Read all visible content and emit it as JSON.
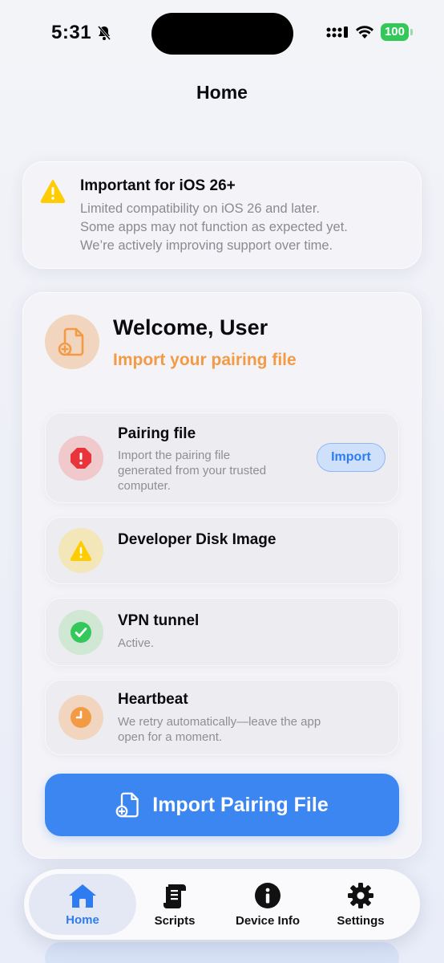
{
  "status_bar": {
    "time": "5:31",
    "battery": "100"
  },
  "nav": {
    "title": "Home"
  },
  "notice": {
    "title": "Important for iOS 26+",
    "lines": [
      "Limited compatibility on iOS 26 and later.",
      "Some apps may not function as expected yet.",
      "We’re actively improving support over time."
    ]
  },
  "welcome": {
    "title": "Welcome, User",
    "subtitle": "Import your pairing file"
  },
  "rows": [
    {
      "title": "Pairing file",
      "desc_lines": [
        "Import the pairing file",
        "generated from your trusted",
        "computer."
      ],
      "action": "Import",
      "status": "error"
    },
    {
      "title": "Developer Disk Image",
      "status": "warning"
    },
    {
      "title": "VPN tunnel",
      "desc_lines": [
        "Active."
      ],
      "status": "ok"
    },
    {
      "title": "Heartbeat",
      "desc_lines": [
        "We retry automatically—leave the app",
        "open for a moment."
      ],
      "status": "pending"
    }
  ],
  "primary_button": {
    "label": "Import Pairing File"
  },
  "tabs": [
    {
      "label": "Home",
      "icon": "house-icon"
    },
    {
      "label": "Scripts",
      "icon": "scroll-icon"
    },
    {
      "label": "Device Info",
      "icon": "info-icon"
    },
    {
      "label": "Settings",
      "icon": "gear-icon"
    }
  ],
  "colors": {
    "accent": "#3c86f2",
    "orange": "#f39a45",
    "error": "#e8353c",
    "warning": "#ffcc00",
    "success": "#34c759"
  }
}
